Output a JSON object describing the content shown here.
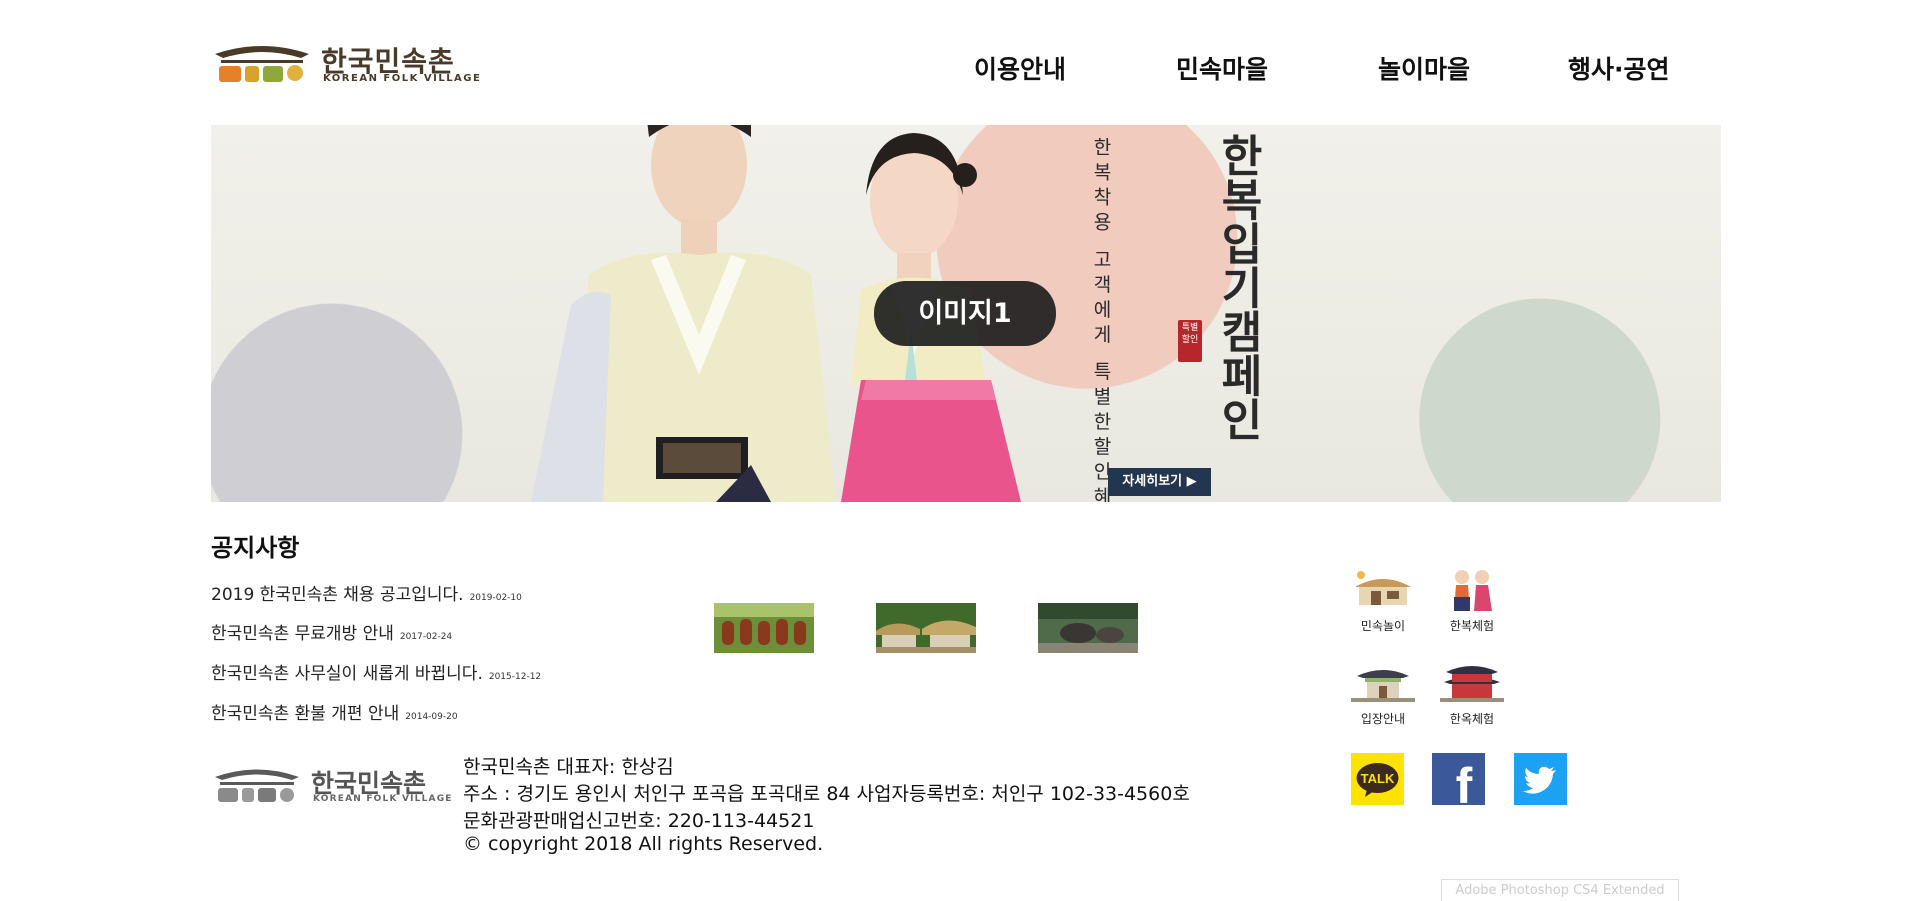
{
  "logo": {
    "name": "한국민속촌",
    "subtitle": "KOREAN FOLK VILLAGE"
  },
  "nav": [
    {
      "label": "이용안내"
    },
    {
      "label": "민속마을"
    },
    {
      "label": "놀이마을"
    },
    {
      "label": "행사·공연"
    }
  ],
  "banner": {
    "headline_col1": "한복입기",
    "headline_col2": "캠페인",
    "subline_col1": "한복착용 고객에게 특별한",
    "subline_col2": "할인혜택을 드립니다",
    "stamp": "특별할인",
    "more_button": "자세히보기 ▶",
    "caption": "이미지1"
  },
  "notices": {
    "title": "공지사항",
    "items": [
      {
        "text": "2019 한국민속촌 채용 공고입니다.",
        "date": "2019-02-10"
      },
      {
        "text": "한국민속촌 무료개방 안내",
        "date": "2017-02-24"
      },
      {
        "text": "한국민속촌 사무실이 새롭게 바뀝니다.",
        "date": "2015-12-12"
      },
      {
        "text": "한국민속촌 환불 개편 안내",
        "date": "2014-09-20"
      }
    ]
  },
  "quick_links": [
    {
      "label": "민속놀이",
      "icon": "folk-house-icon"
    },
    {
      "label": "한복체험",
      "icon": "hanbok-couple-icon"
    },
    {
      "label": "입장안내",
      "icon": "gate-pavilion-icon"
    },
    {
      "label": "한옥체험",
      "icon": "palace-icon"
    }
  ],
  "social": [
    {
      "label": "TALK",
      "icon": "kakao-talk-icon",
      "color": "#FFE300"
    },
    {
      "label": "f",
      "icon": "facebook-icon",
      "color": "#3B5998"
    },
    {
      "label": "",
      "icon": "twitter-icon",
      "color": "#1DA1F2"
    }
  ],
  "footer": {
    "line1": "한국민속촌 대표자: 한상김",
    "line2": "주소 : 경기도 용인시 처인구 포곡읍 포곡대로 84 사업자등록번호: 처인구 102-33-4560호",
    "line3": "문화관광판매업신고번호: 220-113-44521",
    "line4": "© copyright 2018 All rights Reserved."
  },
  "overlay_note": "Adobe Photoshop CS4 Extended"
}
